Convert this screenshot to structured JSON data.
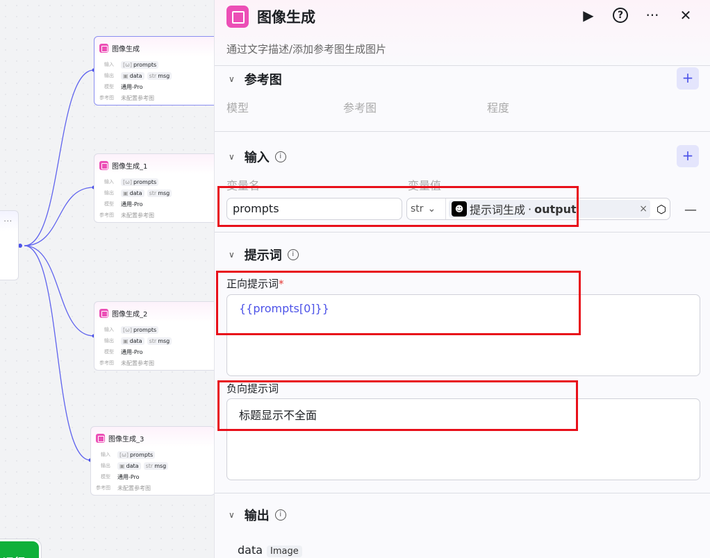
{
  "canvas": {
    "nodes": [
      {
        "title": "图像生成",
        "input_label": "输入",
        "input": "prompts",
        "output_label": "输出",
        "outputs": [
          "data",
          "msg"
        ],
        "model_label": "模型",
        "model": "通用-Pro",
        "ref_label": "参考图",
        "ref": "未配置参考图"
      },
      {
        "title": "图像生成_1",
        "input_label": "输入",
        "input": "prompts",
        "output_label": "输出",
        "outputs": [
          "data",
          "msg"
        ],
        "model_label": "模型",
        "model": "通用-Pro",
        "ref_label": "参考图",
        "ref": "未配置参考图"
      },
      {
        "title": "图像生成_2",
        "input_label": "输入",
        "input": "prompts",
        "output_label": "输出",
        "outputs": [
          "data",
          "msg"
        ],
        "model_label": "模型",
        "model": "通用-Pro",
        "ref_label": "参考图",
        "ref": "未配置参考图"
      },
      {
        "title": "图像生成_3",
        "input_label": "输入",
        "input": "prompts",
        "output_label": "输出",
        "outputs": [
          "data",
          "msg"
        ],
        "model_label": "模型",
        "model": "通用-Pro",
        "ref_label": "参考图",
        "ref": "未配置参考图"
      }
    ],
    "more": "···",
    "run_label": "运行"
  },
  "panel": {
    "title": "图像生成",
    "subtitle": "通过文字描述/添加参考图生成图片",
    "reference": {
      "title": "参考图",
      "cols": [
        "模型",
        "参考图",
        "程度"
      ]
    },
    "input": {
      "title": "输入",
      "cols": [
        "变量名",
        "变量值"
      ],
      "name": "prompts",
      "type": "str",
      "source_node": "提示词生成",
      "source_field": "output"
    },
    "prompt": {
      "title": "提示词",
      "positive_label": "正向提示词",
      "positive_value": "{{prompts[0]}}",
      "negative_label": "负向提示词",
      "negative_value": "标题显示不全面"
    },
    "output": {
      "title": "输出",
      "field": "data",
      "field_type": "Image"
    }
  }
}
